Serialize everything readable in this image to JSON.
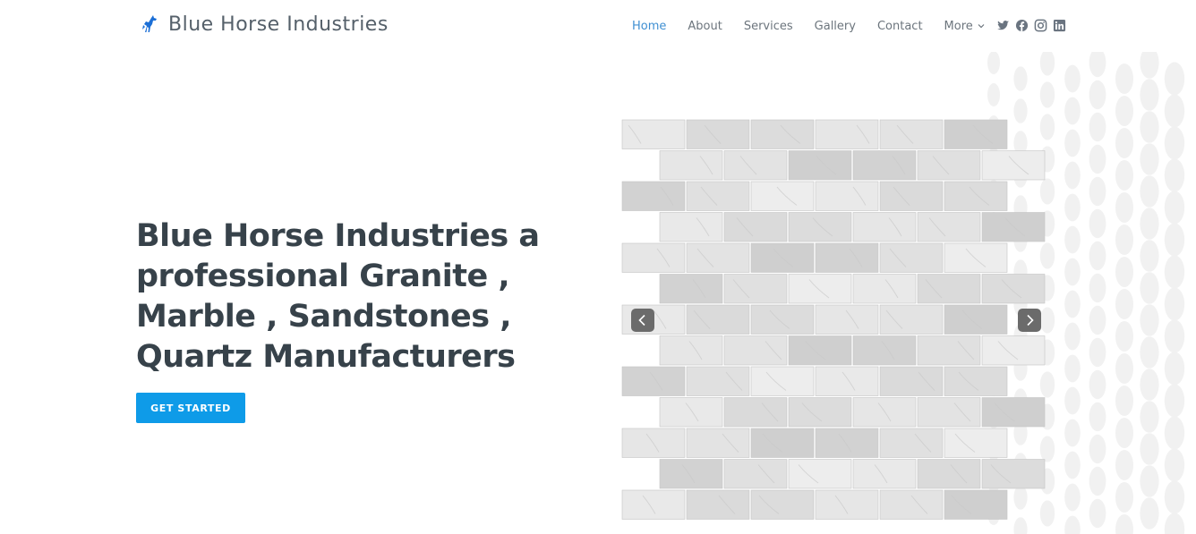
{
  "brand": {
    "name": "Blue Horse Industries",
    "logo_icon": "horse-icon",
    "accent_color": "#1c6fd6"
  },
  "nav": {
    "items": [
      "Home",
      "About",
      "Services",
      "Gallery",
      "Contact"
    ],
    "more_label": "More",
    "active": "Home",
    "active_color": "#3f8fd2"
  },
  "social": {
    "icons": [
      "twitter-icon",
      "facebook-icon",
      "instagram-icon",
      "linkedin-icon"
    ]
  },
  "hero": {
    "title": "Blue Horse Industries a professional Granite , Marble , Sandstones , Quartz Manufacturers",
    "cta_label": "GET STARTED",
    "cta_color": "#0e9be8"
  },
  "slider": {
    "image": "white-marble-split-face-mosaic-tile",
    "prev_icon": "chevron-left-icon",
    "next_icon": "chevron-right-icon"
  }
}
